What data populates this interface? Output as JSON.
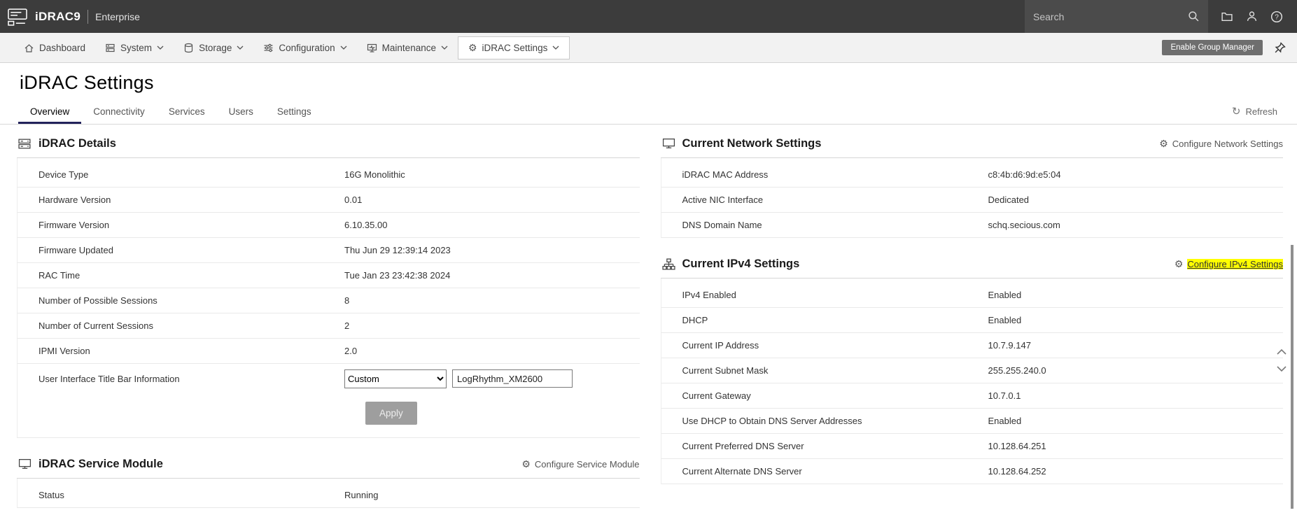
{
  "colors": {
    "topbar_bg": "#3c3c3c",
    "searchbox_bg": "#4b4b4b",
    "navbar_bg": "#f2f2f2",
    "tab_active_underline": "#23235b",
    "group_button_bg": "#6e6e6e",
    "find_highlight": "#ffff00",
    "apply_button_bg": "#9e9e9e"
  },
  "glyphs": {
    "gear": "⚙",
    "refresh": "↻"
  },
  "topbar": {
    "brand": "iDRAC9",
    "edition": "Enterprise",
    "search_placeholder": "Search"
  },
  "nav": {
    "items": [
      {
        "label": "Dashboard"
      },
      {
        "label": "System"
      },
      {
        "label": "Storage"
      },
      {
        "label": "Configuration"
      },
      {
        "label": "Maintenance"
      },
      {
        "label": "iDRAC Settings"
      }
    ],
    "group_manager_label": "Enable Group Manager"
  },
  "page": {
    "title": "iDRAC Settings",
    "refresh_label": "Refresh"
  },
  "tabs": [
    {
      "label": "Overview",
      "active": true
    },
    {
      "label": "Connectivity",
      "active": false
    },
    {
      "label": "Services",
      "active": false
    },
    {
      "label": "Users",
      "active": false
    },
    {
      "label": "Settings",
      "active": false
    }
  ],
  "idrac_details": {
    "title": "iDRAC Details",
    "rows": [
      {
        "label": "Device Type",
        "value": "16G Monolithic"
      },
      {
        "label": "Hardware Version",
        "value": "0.01"
      },
      {
        "label": "Firmware Version",
        "value": "6.10.35.00"
      },
      {
        "label": "Firmware Updated",
        "value": "Thu Jun 29 12:39:14 2023"
      },
      {
        "label": "RAC Time",
        "value": "Tue Jan 23 23:42:38 2024"
      },
      {
        "label": "Number of Possible Sessions",
        "value": "8"
      },
      {
        "label": "Number of Current Sessions",
        "value": "2"
      },
      {
        "label": "IPMI Version",
        "value": "2.0"
      }
    ],
    "title_bar_row": {
      "label": "User Interface Title Bar Information",
      "select_value": "Custom",
      "input_value": "LogRhythm_XM2600"
    },
    "apply_label": "Apply"
  },
  "service_module": {
    "title": "iDRAC Service Module",
    "configure_label": "Configure Service Module",
    "rows": [
      {
        "label": "Status",
        "value": "Running"
      }
    ]
  },
  "network_settings": {
    "title": "Current Network Settings",
    "configure_label": "Configure Network Settings",
    "rows": [
      {
        "label": "iDRAC MAC Address",
        "value": "c8:4b:d6:9d:e5:04"
      },
      {
        "label": "Active NIC Interface",
        "value": "Dedicated"
      },
      {
        "label": "DNS Domain Name",
        "value": "schq.secious.com"
      }
    ]
  },
  "ipv4_settings": {
    "title": "Current IPv4 Settings",
    "configure_label": "Configure IPv4 Settings",
    "rows": [
      {
        "label": "IPv4 Enabled",
        "value": "Enabled"
      },
      {
        "label": "DHCP",
        "value": "Enabled"
      },
      {
        "label": "Current IP Address",
        "value": "10.7.9.147"
      },
      {
        "label": "Current Subnet Mask",
        "value": "255.255.240.0"
      },
      {
        "label": "Current Gateway",
        "value": "10.7.0.1"
      },
      {
        "label": "Use DHCP to Obtain DNS Server Addresses",
        "value": "Enabled"
      },
      {
        "label": "Current Preferred DNS Server",
        "value": "10.128.64.251"
      },
      {
        "label": "Current Alternate DNS Server",
        "value": "10.128.64.252"
      }
    ]
  }
}
